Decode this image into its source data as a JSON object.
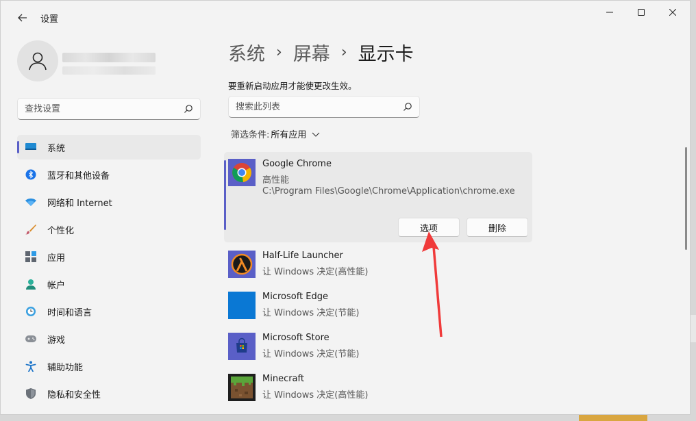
{
  "window": {
    "title": "设置",
    "back_icon": "back-arrow-icon",
    "controls": [
      "minimize-icon",
      "maximize-icon",
      "close-icon"
    ]
  },
  "sidebar": {
    "search_placeholder": "查找设置",
    "items": [
      {
        "label": "系统",
        "icon": "system-display-icon",
        "active": true
      },
      {
        "label": "蓝牙和其他设备",
        "icon": "bluetooth-icon"
      },
      {
        "label": "网络和 Internet",
        "icon": "wifi-icon"
      },
      {
        "label": "个性化",
        "icon": "brush-icon"
      },
      {
        "label": "应用",
        "icon": "apps-icon"
      },
      {
        "label": "帐户",
        "icon": "account-icon"
      },
      {
        "label": "时间和语言",
        "icon": "clock-globe-icon"
      },
      {
        "label": "游戏",
        "icon": "gamepad-icon"
      },
      {
        "label": "辅助功能",
        "icon": "accessibility-icon"
      },
      {
        "label": "隐私和安全性",
        "icon": "shield-icon"
      }
    ]
  },
  "main": {
    "breadcrumb": [
      "系统",
      "屏幕",
      "显示卡"
    ],
    "description_line": "要重新启动应用才能使更改生效。",
    "list_search_placeholder": "搜索此列表",
    "filter_label": "筛选条件:",
    "filter_value": "所有应用",
    "apps": [
      {
        "name": "Google Chrome",
        "mode": "高性能",
        "path": "C:\\Program Files\\Google\\Chrome\\Application\\chrome.exe",
        "expanded": true,
        "options_label": "选项",
        "delete_label": "删除",
        "icon": "chrome-icon"
      },
      {
        "name": "Half-Life Launcher",
        "mode": "让 Windows 决定(高性能)",
        "icon": "half-life-icon"
      },
      {
        "name": "Microsoft Edge",
        "mode": "让 Windows 决定(节能)",
        "icon": "edge-icon"
      },
      {
        "name": "Microsoft Store",
        "mode": "让 Windows 决定(节能)",
        "icon": "store-icon"
      },
      {
        "name": "Minecraft",
        "mode": "让 Windows 决定(高性能)",
        "icon": "minecraft-icon"
      }
    ]
  },
  "colors": {
    "accent": "#5a5fc7",
    "annotation_arrow": "#f03a3a",
    "window_bg": "#f3f3f3"
  }
}
